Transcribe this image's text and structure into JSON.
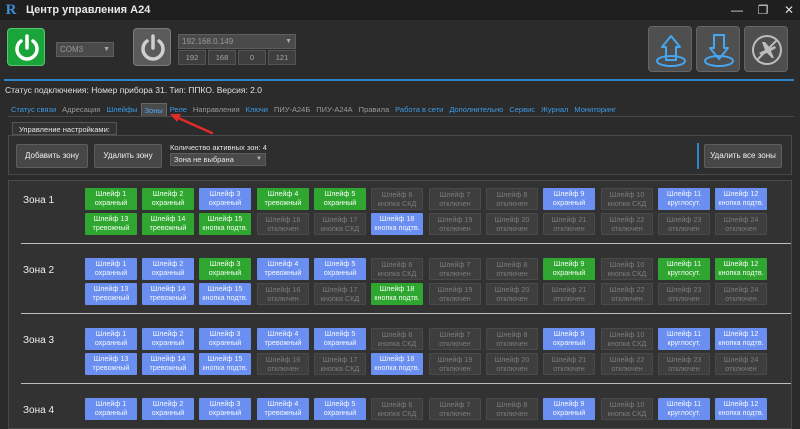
{
  "app": {
    "logo": "R",
    "title": "Центр управления А24",
    "window_controls": [
      "—",
      "❐",
      "✕"
    ]
  },
  "connection": {
    "com_port": "COM3",
    "ip_address": "192.168.0.149",
    "ip_octets": [
      "192",
      "168",
      "0",
      "121"
    ]
  },
  "status_line": "Статус подключения: Номер прибора 31. Тип: ППКО. Версия: 2.0",
  "tabs": [
    {
      "label": "Статус связи",
      "state": "normal"
    },
    {
      "label": "Адресация",
      "state": "gray"
    },
    {
      "label": "Шлейфы",
      "state": "normal"
    },
    {
      "label": "Зоны",
      "state": "active"
    },
    {
      "label": "Реле",
      "state": "normal"
    },
    {
      "label": "Направления",
      "state": "gray"
    },
    {
      "label": "Ключи",
      "state": "normal"
    },
    {
      "label": "ПИУ-А24Б",
      "state": "gray"
    },
    {
      "label": "ПИУ-А24А",
      "state": "gray"
    },
    {
      "label": "Правила",
      "state": "gray"
    },
    {
      "label": "Работа в сети",
      "state": "normal"
    },
    {
      "label": "Дополнительно",
      "state": "normal"
    },
    {
      "label": "Сервис",
      "state": "normal"
    },
    {
      "label": "Журнал",
      "state": "normal"
    },
    {
      "label": "Мониторинг",
      "state": "normal"
    }
  ],
  "settings": {
    "group_title": "Управление настройками:",
    "add_zone": "Добавить зону",
    "delete_zone": "Удалить зону",
    "active_count_label": "Количество активных зон: 4",
    "zone_select_value": "Зона не выбрана",
    "delete_all": "Удалить все зоны"
  },
  "colors": {
    "green": "#2fa62f",
    "blue": "#6a8ff0",
    "gray": "#3e3e3e",
    "accent": "#2d86c9"
  },
  "zones": [
    {
      "name": "Зона 1",
      "loops": [
        {
          "line1": "Шлейф 1",
          "line2": "охранный",
          "state": "green"
        },
        {
          "line1": "Шлейф 2",
          "line2": "охранный",
          "state": "green"
        },
        {
          "line1": "Шлейф 3",
          "line2": "охранный",
          "state": "blue"
        },
        {
          "line1": "Шлейф 4",
          "line2": "тревожный",
          "state": "green"
        },
        {
          "line1": "Шлейф 5",
          "line2": "охранный",
          "state": "green"
        },
        {
          "line1": "Шлейф 6",
          "line2": "кнопка СКД",
          "state": "gray"
        },
        {
          "line1": "Шлейф 7",
          "line2": "отключен",
          "state": "gray"
        },
        {
          "line1": "Шлейф 8",
          "line2": "отключен",
          "state": "gray"
        },
        {
          "line1": "Шлейф 9",
          "line2": "охранный",
          "state": "blue"
        },
        {
          "line1": "Шлейф 10",
          "line2": "кнопка СКД",
          "state": "gray"
        },
        {
          "line1": "Шлейф 11",
          "line2": "круглосут.",
          "state": "blue"
        },
        {
          "line1": "Шлейф 12",
          "line2": "кнопка подтв.",
          "state": "blue"
        },
        {
          "line1": "Шлейф 13",
          "line2": "тревожный",
          "state": "green"
        },
        {
          "line1": "Шлейф 14",
          "line2": "тревожный",
          "state": "green"
        },
        {
          "line1": "Шлейф 15",
          "line2": "кнопка подтв.",
          "state": "green"
        },
        {
          "line1": "Шлейф 16",
          "line2": "отключен",
          "state": "gray"
        },
        {
          "line1": "Шлейф 17",
          "line2": "кнопка СКД",
          "state": "gray"
        },
        {
          "line1": "Шлейф 18",
          "line2": "кнопка подтв.",
          "state": "blue"
        },
        {
          "line1": "Шлейф 19",
          "line2": "отключен",
          "state": "gray"
        },
        {
          "line1": "Шлейф 20",
          "line2": "отключен",
          "state": "gray"
        },
        {
          "line1": "Шлейф 21",
          "line2": "отключен",
          "state": "gray"
        },
        {
          "line1": "Шлейф 22",
          "line2": "отключен",
          "state": "gray"
        },
        {
          "line1": "Шлейф 23",
          "line2": "отключен",
          "state": "gray"
        },
        {
          "line1": "Шлейф 24",
          "line2": "отключен",
          "state": "gray"
        }
      ]
    },
    {
      "name": "Зона 2",
      "loops": [
        {
          "line1": "Шлейф 1",
          "line2": "охранный",
          "state": "blue"
        },
        {
          "line1": "Шлейф 2",
          "line2": "охранный",
          "state": "blue"
        },
        {
          "line1": "Шлейф 3",
          "line2": "охранный",
          "state": "green"
        },
        {
          "line1": "Шлейф 4",
          "line2": "тревожный",
          "state": "blue"
        },
        {
          "line1": "Шлейф 5",
          "line2": "охранный",
          "state": "blue"
        },
        {
          "line1": "Шлейф 6",
          "line2": "кнопка СКД",
          "state": "gray"
        },
        {
          "line1": "Шлейф 7",
          "line2": "отключен",
          "state": "gray"
        },
        {
          "line1": "Шлейф 8",
          "line2": "отключен",
          "state": "gray"
        },
        {
          "line1": "Шлейф 9",
          "line2": "охранный",
          "state": "green"
        },
        {
          "line1": "Шлейф 10",
          "line2": "кнопка СКД",
          "state": "gray"
        },
        {
          "line1": "Шлейф 11",
          "line2": "круглосут.",
          "state": "green"
        },
        {
          "line1": "Шлейф 12",
          "line2": "кнопка подтв.",
          "state": "green"
        },
        {
          "line1": "Шлейф 13",
          "line2": "тревожный",
          "state": "blue"
        },
        {
          "line1": "Шлейф 14",
          "line2": "тревожный",
          "state": "blue"
        },
        {
          "line1": "Шлейф 15",
          "line2": "кнопка подтв.",
          "state": "blue"
        },
        {
          "line1": "Шлейф 16",
          "line2": "отключен",
          "state": "gray"
        },
        {
          "line1": "Шлейф 17",
          "line2": "кнопка СКД",
          "state": "gray"
        },
        {
          "line1": "Шлейф 18",
          "line2": "кнопка подтв.",
          "state": "green"
        },
        {
          "line1": "Шлейф 19",
          "line2": "отключен",
          "state": "gray"
        },
        {
          "line1": "Шлейф 20",
          "line2": "отключен",
          "state": "gray"
        },
        {
          "line1": "Шлейф 21",
          "line2": "отключен",
          "state": "gray"
        },
        {
          "line1": "Шлейф 22",
          "line2": "отключен",
          "state": "gray"
        },
        {
          "line1": "Шлейф 23",
          "line2": "отключен",
          "state": "gray"
        },
        {
          "line1": "Шлейф 24",
          "line2": "отключен",
          "state": "gray"
        }
      ]
    },
    {
      "name": "Зона 3",
      "loops": [
        {
          "line1": "Шлейф 1",
          "line2": "охранный",
          "state": "blue"
        },
        {
          "line1": "Шлейф 2",
          "line2": "охранный",
          "state": "blue"
        },
        {
          "line1": "Шлейф 3",
          "line2": "охранный",
          "state": "blue"
        },
        {
          "line1": "Шлейф 4",
          "line2": "тревожный",
          "state": "blue"
        },
        {
          "line1": "Шлейф 5",
          "line2": "охранный",
          "state": "blue"
        },
        {
          "line1": "Шлейф 6",
          "line2": "кнопка СКД",
          "state": "gray"
        },
        {
          "line1": "Шлейф 7",
          "line2": "отключен",
          "state": "gray"
        },
        {
          "line1": "Шлейф 8",
          "line2": "отключен",
          "state": "gray"
        },
        {
          "line1": "Шлейф 9",
          "line2": "охранный",
          "state": "blue"
        },
        {
          "line1": "Шлейф 10",
          "line2": "кнопка СКД",
          "state": "gray"
        },
        {
          "line1": "Шлейф 11",
          "line2": "круглосут.",
          "state": "blue"
        },
        {
          "line1": "Шлейф 12",
          "line2": "кнопка подтв.",
          "state": "blue"
        },
        {
          "line1": "Шлейф 13",
          "line2": "тревожный",
          "state": "blue"
        },
        {
          "line1": "Шлейф 14",
          "line2": "тревожный",
          "state": "blue"
        },
        {
          "line1": "Шлейф 15",
          "line2": "кнопка подтв.",
          "state": "blue"
        },
        {
          "line1": "Шлейф 16",
          "line2": "отключен",
          "state": "gray"
        },
        {
          "line1": "Шлейф 17",
          "line2": "кнопка СКД",
          "state": "gray"
        },
        {
          "line1": "Шлейф 18",
          "line2": "кнопка подтв.",
          "state": "blue"
        },
        {
          "line1": "Шлейф 19",
          "line2": "отключен",
          "state": "gray"
        },
        {
          "line1": "Шлейф 20",
          "line2": "отключен",
          "state": "gray"
        },
        {
          "line1": "Шлейф 21",
          "line2": "отключен",
          "state": "gray"
        },
        {
          "line1": "Шлейф 22",
          "line2": "отключен",
          "state": "gray"
        },
        {
          "line1": "Шлейф 23",
          "line2": "отключен",
          "state": "gray"
        },
        {
          "line1": "Шлейф 24",
          "line2": "отключен",
          "state": "gray"
        }
      ]
    },
    {
      "name": "Зона 4",
      "loops": [
        {
          "line1": "Шлейф 1",
          "line2": "охранный",
          "state": "blue"
        },
        {
          "line1": "Шлейф 2",
          "line2": "охранный",
          "state": "blue"
        },
        {
          "line1": "Шлейф 3",
          "line2": "охранный",
          "state": "blue"
        },
        {
          "line1": "Шлейф 4",
          "line2": "тревожный",
          "state": "blue"
        },
        {
          "line1": "Шлейф 5",
          "line2": "охранный",
          "state": "blue"
        },
        {
          "line1": "Шлейф 6",
          "line2": "кнопка СКД",
          "state": "gray"
        },
        {
          "line1": "Шлейф 7",
          "line2": "отключен",
          "state": "gray"
        },
        {
          "line1": "Шлейф 8",
          "line2": "отключен",
          "state": "gray"
        },
        {
          "line1": "Шлейф 9",
          "line2": "охранный",
          "state": "blue"
        },
        {
          "line1": "Шлейф 10",
          "line2": "кнопка СКД",
          "state": "gray"
        },
        {
          "line1": "Шлейф 11",
          "line2": "круглосут.",
          "state": "blue"
        },
        {
          "line1": "Шлейф 12",
          "line2": "кнопка подтв.",
          "state": "blue"
        }
      ]
    }
  ]
}
